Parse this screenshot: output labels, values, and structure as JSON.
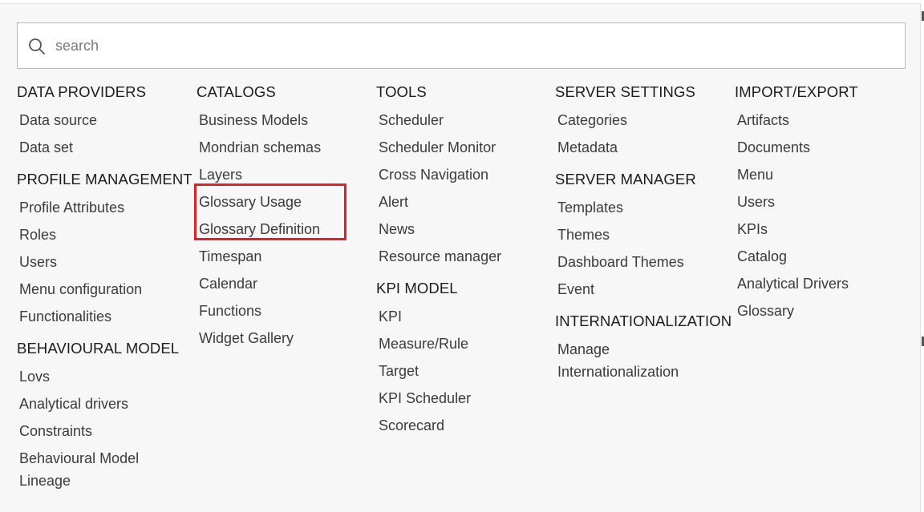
{
  "search": {
    "placeholder": "search",
    "icon": "search-icon"
  },
  "highlight_color": "#e01f2b",
  "columns": [
    {
      "sections": [
        {
          "title": "DATA PROVIDERS",
          "items": [
            "Data source",
            "Data set"
          ]
        },
        {
          "title": "PROFILE MANAGEMENT",
          "items": [
            "Profile Attributes",
            "Roles",
            "Users",
            "Menu configuration",
            "Functionalities"
          ]
        },
        {
          "title": "BEHAVIOURAL MODEL",
          "items": [
            "Lovs",
            "Analytical drivers",
            "Constraints",
            "Behavioural Model Lineage"
          ]
        }
      ]
    },
    {
      "sections": [
        {
          "title": "CATALOGS",
          "items": [
            "Business Models",
            "Mondrian schemas",
            "Layers",
            "Glossary Usage",
            "Glossary Definition",
            "Timespan",
            "Calendar",
            "Functions",
            "Widget Gallery"
          ]
        }
      ]
    },
    {
      "sections": [
        {
          "title": "TOOLS",
          "items": [
            "Scheduler",
            "Scheduler Monitor",
            "Cross Navigation",
            "Alert",
            "News",
            "Resource manager"
          ]
        },
        {
          "title": "KPI MODEL",
          "items": [
            "KPI",
            "Measure/Rule",
            "Target",
            "KPI Scheduler",
            "Scorecard"
          ]
        }
      ]
    },
    {
      "sections": [
        {
          "title": "SERVER SETTINGS",
          "items": [
            "Categories",
            "Metadata"
          ]
        },
        {
          "title": "SERVER MANAGER",
          "items": [
            "Templates",
            "Themes",
            "Dashboard Themes",
            "Event"
          ]
        },
        {
          "title": "INTERNATIONALIZATION",
          "items": [
            "Manage Internationalization"
          ]
        }
      ]
    },
    {
      "sections": [
        {
          "title": "IMPORT/EXPORT",
          "items": [
            "Artifacts",
            "Documents",
            "Menu",
            "Users",
            "KPIs",
            "Catalog",
            "Analytical Drivers",
            "Glossary"
          ]
        }
      ]
    }
  ]
}
